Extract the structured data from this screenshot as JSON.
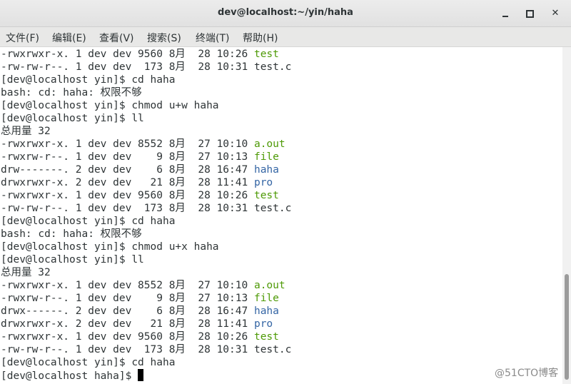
{
  "window": {
    "title": "dev@localhost:~/yin/haha",
    "controls": {
      "minimize_icon": "minimize-icon",
      "maximize_icon": "maximize-icon",
      "close_glyph": "✕"
    }
  },
  "menu": [
    {
      "label": "文件(F)"
    },
    {
      "label": "编辑(E)"
    },
    {
      "label": "查看(V)"
    },
    {
      "label": "搜索(S)"
    },
    {
      "label": "终端(T)"
    },
    {
      "label": "帮助(H)"
    }
  ],
  "colors": {
    "executable": "#4e9a06",
    "directory": "#3465a4",
    "text": "#2e3436"
  },
  "terminal": {
    "lines": [
      {
        "prefix": "-rwxrwxr-x. 1 dev dev 9560 8月  28 10:26 ",
        "name": "test",
        "type": "exec"
      },
      {
        "prefix": "-rw-rw-r--. 1 dev dev  173 8月  28 10:31 ",
        "name": "test.c",
        "type": "plain"
      },
      {
        "prefix": "[dev@localhost yin]$ cd haha",
        "name": "",
        "type": "plain"
      },
      {
        "prefix": "bash: cd: haha: 权限不够",
        "name": "",
        "type": "plain"
      },
      {
        "prefix": "[dev@localhost yin]$ chmod u+w haha",
        "name": "",
        "type": "plain"
      },
      {
        "prefix": "[dev@localhost yin]$ ll",
        "name": "",
        "type": "plain"
      },
      {
        "prefix": "总用量 32",
        "name": "",
        "type": "plain"
      },
      {
        "prefix": "-rwxrwxr-x. 1 dev dev 8552 8月  27 10:10 ",
        "name": "a.out",
        "type": "exec"
      },
      {
        "prefix": "-rwxrw-r--. 1 dev dev    9 8月  27 10:13 ",
        "name": "file",
        "type": "exec"
      },
      {
        "prefix": "drw-------. 2 dev dev    6 8月  28 16:47 ",
        "name": "haha",
        "type": "dir"
      },
      {
        "prefix": "drwxrwxr-x. 2 dev dev   21 8月  28 11:41 ",
        "name": "pro",
        "type": "dir"
      },
      {
        "prefix": "-rwxrwxr-x. 1 dev dev 9560 8月  28 10:26 ",
        "name": "test",
        "type": "exec"
      },
      {
        "prefix": "-rw-rw-r--. 1 dev dev  173 8月  28 10:31 ",
        "name": "test.c",
        "type": "plain"
      },
      {
        "prefix": "[dev@localhost yin]$ cd haha",
        "name": "",
        "type": "plain"
      },
      {
        "prefix": "bash: cd: haha: 权限不够",
        "name": "",
        "type": "plain"
      },
      {
        "prefix": "[dev@localhost yin]$ chmod u+x haha",
        "name": "",
        "type": "plain"
      },
      {
        "prefix": "[dev@localhost yin]$ ll",
        "name": "",
        "type": "plain"
      },
      {
        "prefix": "总用量 32",
        "name": "",
        "type": "plain"
      },
      {
        "prefix": "-rwxrwxr-x. 1 dev dev 8552 8月  27 10:10 ",
        "name": "a.out",
        "type": "exec"
      },
      {
        "prefix": "-rwxrw-r--. 1 dev dev    9 8月  27 10:13 ",
        "name": "file",
        "type": "exec"
      },
      {
        "prefix": "drwx------. 2 dev dev    6 8月  28 16:47 ",
        "name": "haha",
        "type": "dir"
      },
      {
        "prefix": "drwxrwxr-x. 2 dev dev   21 8月  28 11:41 ",
        "name": "pro",
        "type": "dir"
      },
      {
        "prefix": "-rwxrwxr-x. 1 dev dev 9560 8月  28 10:26 ",
        "name": "test",
        "type": "exec"
      },
      {
        "prefix": "-rw-rw-r--. 1 dev dev  173 8月  28 10:31 ",
        "name": "test.c",
        "type": "plain"
      },
      {
        "prefix": "[dev@localhost yin]$ cd haha",
        "name": "",
        "type": "plain"
      },
      {
        "prefix": "[dev@localhost haha]$ ",
        "name": "",
        "type": "prompt"
      }
    ]
  },
  "watermark": "@51CTO博客"
}
